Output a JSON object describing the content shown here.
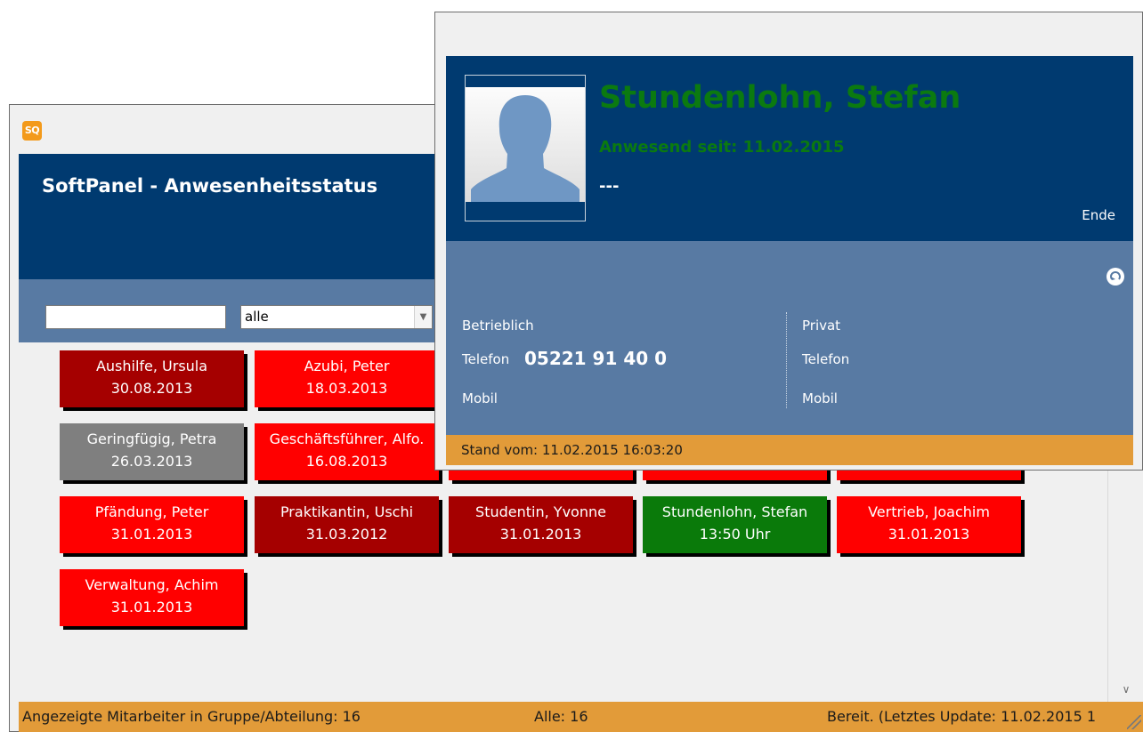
{
  "app": {
    "icon_text": "SQ",
    "title": "SoftPanel - Anwesenheitsstatus"
  },
  "filter": {
    "search_value": "",
    "group_selected": "alle"
  },
  "employees": [
    {
      "name": "Aushilfe, Ursula",
      "info": "30.08.2013",
      "color": "#a50000"
    },
    {
      "name": "Azubi, Peter",
      "info": "18.03.2013",
      "color": "#ff0000"
    },
    {
      "name": "Geringfügig, Petra",
      "info": "26.03.2013",
      "color": "#7f7f7f"
    },
    {
      "name": "Geschäftsführer, Alfo.",
      "info": "16.08.2013",
      "color": "#ff0000"
    },
    {
      "name": "Pfändung, Peter",
      "info": "31.01.2013",
      "color": "#ff0000"
    },
    {
      "name": "Praktikantin, Uschi",
      "info": "31.03.2012",
      "color": "#a50000"
    },
    {
      "name": "Studentin, Yvonne",
      "info": "31.01.2013",
      "color": "#a50000"
    },
    {
      "name": "Stundenlohn, Stefan",
      "info": "13:50 Uhr",
      "color": "#0a7a0a"
    },
    {
      "name": "Vertrieb, Joachim",
      "info": "31.01.2013",
      "color": "#ff0000"
    },
    {
      "name": "Verwaltung, Achim",
      "info": "31.01.2013",
      "color": "#ff0000"
    }
  ],
  "status_bar": {
    "count_label": "Angezeigte Mitarbeiter in Gruppe/Abteilung: 16",
    "all_label": "Alle: 16",
    "ready_label": "Bereit. (Letztes Update: 11.02.2015 1"
  },
  "popup": {
    "name": "Stundenlohn, Stefan",
    "present": "Anwesend seit: 11.02.2015",
    "info": "---",
    "end_label": "Ende",
    "business": {
      "heading": "Betrieblich",
      "phone_label": "Telefon",
      "phone_value": "05221 91 40 0",
      "mobile_label": "Mobil"
    },
    "private": {
      "heading": "Privat",
      "phone_label": "Telefon",
      "mobile_label": "Mobil"
    },
    "status": "Stand vom: 11.02.2015 16:03:20"
  }
}
